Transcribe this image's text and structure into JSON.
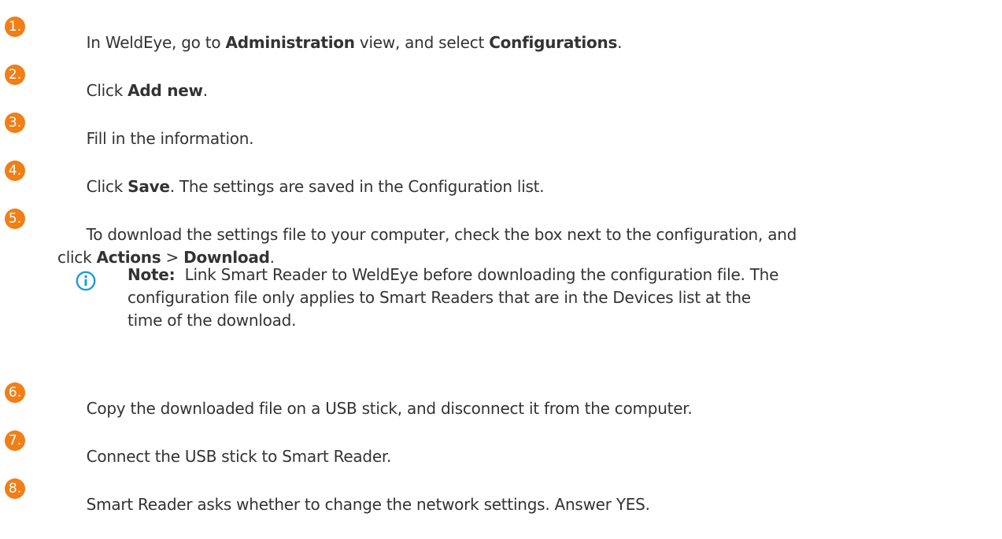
{
  "accent_color": "#f07f19",
  "info_color": "#1a9cd8",
  "steps": [
    {
      "number": "1.",
      "parts": [
        {
          "text": "In WeldEye, go to ",
          "bold": false
        },
        {
          "text": "Administration",
          "bold": true
        },
        {
          "text": " view, and select ",
          "bold": false
        },
        {
          "text": "Configurations",
          "bold": true
        },
        {
          "text": ".",
          "bold": false
        }
      ]
    },
    {
      "number": "2.",
      "parts": [
        {
          "text": "Click ",
          "bold": false
        },
        {
          "text": "Add new",
          "bold": true
        },
        {
          "text": ".",
          "bold": false
        }
      ]
    },
    {
      "number": "3.",
      "parts": [
        {
          "text": "Fill in the information.",
          "bold": false
        }
      ]
    },
    {
      "number": "4.",
      "parts": [
        {
          "text": "Click ",
          "bold": false
        },
        {
          "text": "Save",
          "bold": true
        },
        {
          "text": ". The settings are saved in the Configuration list.",
          "bold": false
        }
      ]
    },
    {
      "number": "5.",
      "parts": [
        {
          "text": "To download the settings file to your computer, check the box next to the configuration, and\nclick ",
          "bold": false
        },
        {
          "text": "Actions",
          "bold": true
        },
        {
          "text": " > ",
          "bold": false
        },
        {
          "text": "Download",
          "bold": true
        },
        {
          "text": ".",
          "bold": false
        }
      ]
    },
    {
      "number": "6.",
      "parts": [
        {
          "text": "Copy the downloaded file on a USB stick, and disconnect it from the computer.",
          "bold": false
        }
      ]
    },
    {
      "number": "7.",
      "parts": [
        {
          "text": "Connect the USB stick to Smart Reader.",
          "bold": false
        }
      ]
    },
    {
      "number": "8.",
      "parts": [
        {
          "text": "Smart Reader asks whether to change the network settings. Answer YES.",
          "bold": false
        }
      ]
    }
  ],
  "note": {
    "icon": "info-icon",
    "label": "Note:",
    "line1": "Link Smart Reader to WeldEye before downloading the configuration file. The",
    "line2": "configuration file only applies to Smart Readers that are in the Devices list at the",
    "line3": "time of the download."
  }
}
